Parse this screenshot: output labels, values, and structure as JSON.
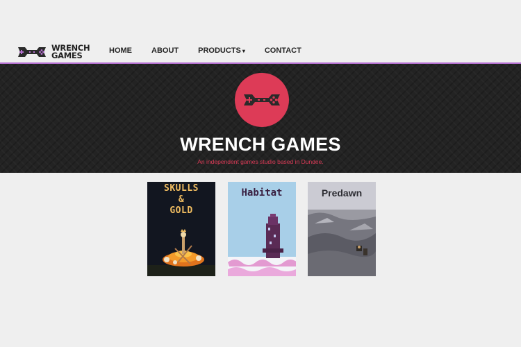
{
  "brand": {
    "logo_line1": "WRENCH",
    "logo_line2": "GAMES",
    "logo_icon": "wrench-controller-icon"
  },
  "nav": {
    "items": [
      {
        "label": "HOME"
      },
      {
        "label": "ABOUT"
      },
      {
        "label": "PRODUCTS",
        "has_dropdown": true
      },
      {
        "label": "CONTACT"
      }
    ]
  },
  "hero": {
    "title": "WRENCH GAMES",
    "subtitle": "An independent games studio based in Dundee.",
    "emblem_icon": "wrench-controller-icon"
  },
  "games": [
    {
      "title_line1": "SKULLS",
      "title_line2": "&",
      "title_line3": "GOLD"
    },
    {
      "title": "Habitat"
    },
    {
      "title": "Predawn"
    }
  ],
  "colors": {
    "accent": "#dd3b57",
    "nav_divider": "#b46fd0",
    "hero_background": "#232323",
    "page_background": "#efefef"
  }
}
